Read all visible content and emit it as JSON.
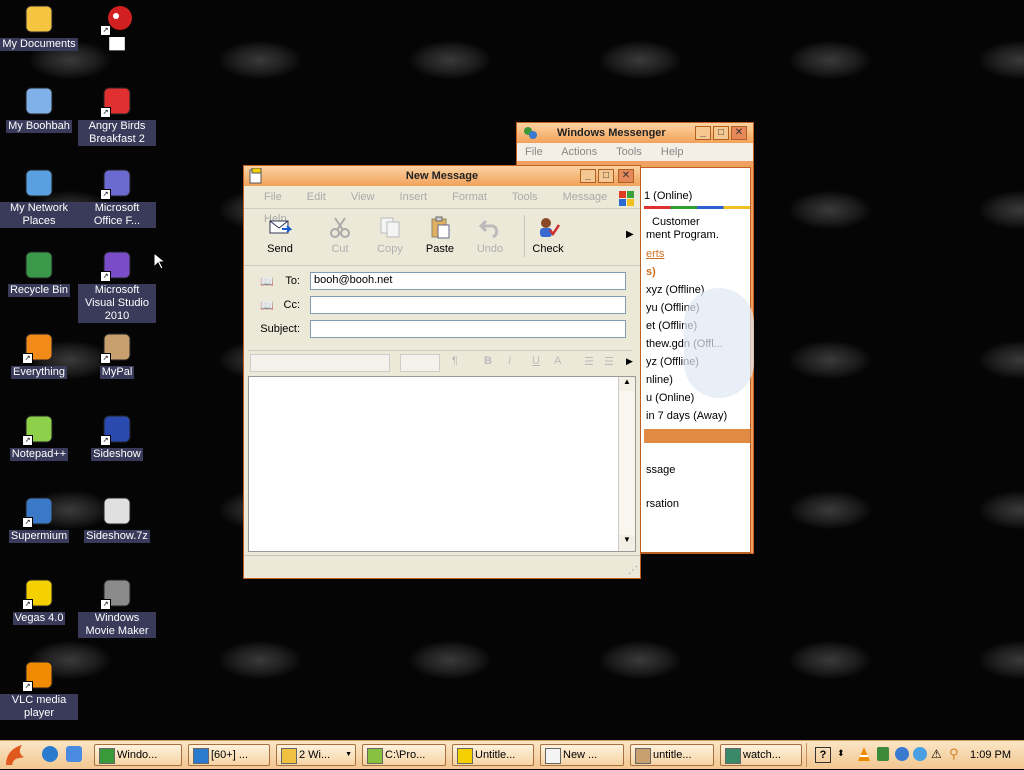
{
  "desktop": {
    "icons": [
      {
        "label": "My Documents",
        "shortcut": false,
        "icon": "folder-documents-icon",
        "color": "#f5c542"
      },
      {
        "label": "My Boohbah",
        "shortcut": false,
        "icon": "computer-icon",
        "color": "#7fb0e8"
      },
      {
        "label": "My Network Places",
        "shortcut": false,
        "icon": "network-places-icon",
        "color": "#5aa0e0"
      },
      {
        "label": "Recycle Bin",
        "shortcut": false,
        "icon": "recycle-bin-icon",
        "color": "#3a9a4a"
      },
      {
        "label": "Everything",
        "shortcut": true,
        "icon": "everything-search-icon",
        "color": "#f28a1a"
      },
      {
        "label": "Notepad++",
        "shortcut": true,
        "icon": "notepad-plus-plus-icon",
        "color": "#8fd04a"
      },
      {
        "label": "Supermium",
        "shortcut": true,
        "icon": "supermium-browser-icon",
        "color": "#3a78c8"
      },
      {
        "label": "Vegas 4.0",
        "shortcut": true,
        "icon": "vegas-icon",
        "color": "#f4d000"
      },
      {
        "label": "VLC media player",
        "shortcut": true,
        "icon": "vlc-cone-icon",
        "color": "#f08a00"
      },
      {
        "label": "Angry Birds Breakfast 2",
        "shortcut": true,
        "icon": "angry-birds-icon",
        "color": "#e03030"
      },
      {
        "label": "Microsoft Office F...",
        "shortcut": true,
        "icon": "office-icon",
        "color": "#6a6ad0"
      },
      {
        "label": "Microsoft Visual Studio 2010",
        "shortcut": true,
        "icon": "visual-studio-icon",
        "color": "#7a4cc8"
      },
      {
        "label": "MyPal",
        "shortcut": true,
        "icon": "mypal-raccoon-icon",
        "color": "#c8a070"
      },
      {
        "label": "Sideshow",
        "shortcut": true,
        "icon": "sideshow-icon",
        "color": "#2a4ab0"
      },
      {
        "label": "Sideshow.7z",
        "shortcut": false,
        "icon": "archive-7z-icon",
        "color": "#e0e0e0"
      },
      {
        "label": "Windows Movie Maker",
        "shortcut": true,
        "icon": "movie-maker-icon",
        "color": "#8a8a8a"
      }
    ],
    "extra_icon_label": "██"
  },
  "messenger": {
    "title": "Windows Messenger",
    "menu": [
      "File",
      "Actions",
      "Tools",
      "Help"
    ],
    "status_line": "1 (Online)",
    "promo_line1": "Customer",
    "promo_line2": "ment Program.",
    "alerts_link": "erts",
    "group_header": "s)",
    "contacts": [
      "xyz (Offline)",
      "yu (Offline)",
      "et (Offline)",
      "thew.gdn (Offl...",
      "yz (Offline)",
      "nline)",
      "u (Online)",
      "in 7 days (Away)"
    ],
    "action1": "ssage",
    "action2": "rsation"
  },
  "new_message": {
    "title": "New Message",
    "menu": [
      "File",
      "Edit",
      "View",
      "Insert",
      "Format",
      "Tools",
      "Message",
      "Help"
    ],
    "toolbar": {
      "send": "Send",
      "cut": "Cut",
      "copy": "Copy",
      "paste": "Paste",
      "undo": "Undo",
      "check": "Check"
    },
    "to_label": "To:",
    "to_value": "booh@booh.net",
    "cc_label": "Cc:",
    "cc_value": "",
    "subject_label": "Subject:",
    "subject_value": ""
  },
  "taskbar": {
    "buttons": [
      {
        "label": "Windo...",
        "icon": "messenger-icon"
      },
      {
        "label": "[60+] ...",
        "icon": "browser-icon"
      },
      {
        "label": "2 Wi...",
        "icon": "folder-icon"
      },
      {
        "label": "C:\\Pro...",
        "icon": "notepad-icon"
      },
      {
        "label": "Untitle...",
        "icon": "vegas-icon"
      },
      {
        "label": "New ...",
        "icon": "new-message-icon"
      },
      {
        "label": "untitle...",
        "icon": "paint-icon"
      },
      {
        "label": "watch...",
        "icon": "image-icon"
      }
    ],
    "clock": "1:09 PM",
    "help_glyph": "?"
  }
}
